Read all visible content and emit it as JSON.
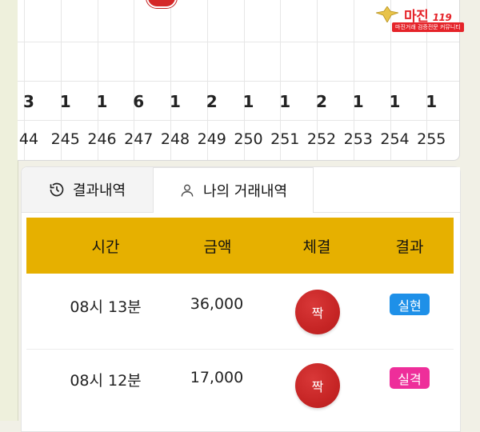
{
  "logo": {
    "name": "마진",
    "suffix": "119",
    "tagline": "마진거래 검증전문 커뮤니티"
  },
  "roadmap": {
    "counts": [
      "3",
      "1",
      "1",
      "6",
      "1",
      "2",
      "1",
      "1",
      "2",
      "1",
      "1",
      "1"
    ],
    "numbers": [
      "44",
      "245",
      "246",
      "247",
      "248",
      "249",
      "250",
      "251",
      "252",
      "253",
      "254",
      "255"
    ]
  },
  "tabs": [
    {
      "label": "결과내역",
      "icon": "history-icon"
    },
    {
      "label": "나의 거래내역",
      "icon": "user-icon"
    }
  ],
  "table": {
    "headers": [
      "시간",
      "금액",
      "체결",
      "결과"
    ],
    "rows": [
      {
        "time": "08시 13분",
        "amount": "36,000",
        "pick": "짝",
        "result": "실현",
        "result_color": "#1e90e8"
      },
      {
        "time": "08시 12분",
        "amount": "17,000",
        "pick": "짝",
        "result": "실격",
        "result_color": "#ee2e9a"
      }
    ]
  },
  "colors": {
    "header_bg": "#e6b000",
    "ball": "#c62525"
  }
}
